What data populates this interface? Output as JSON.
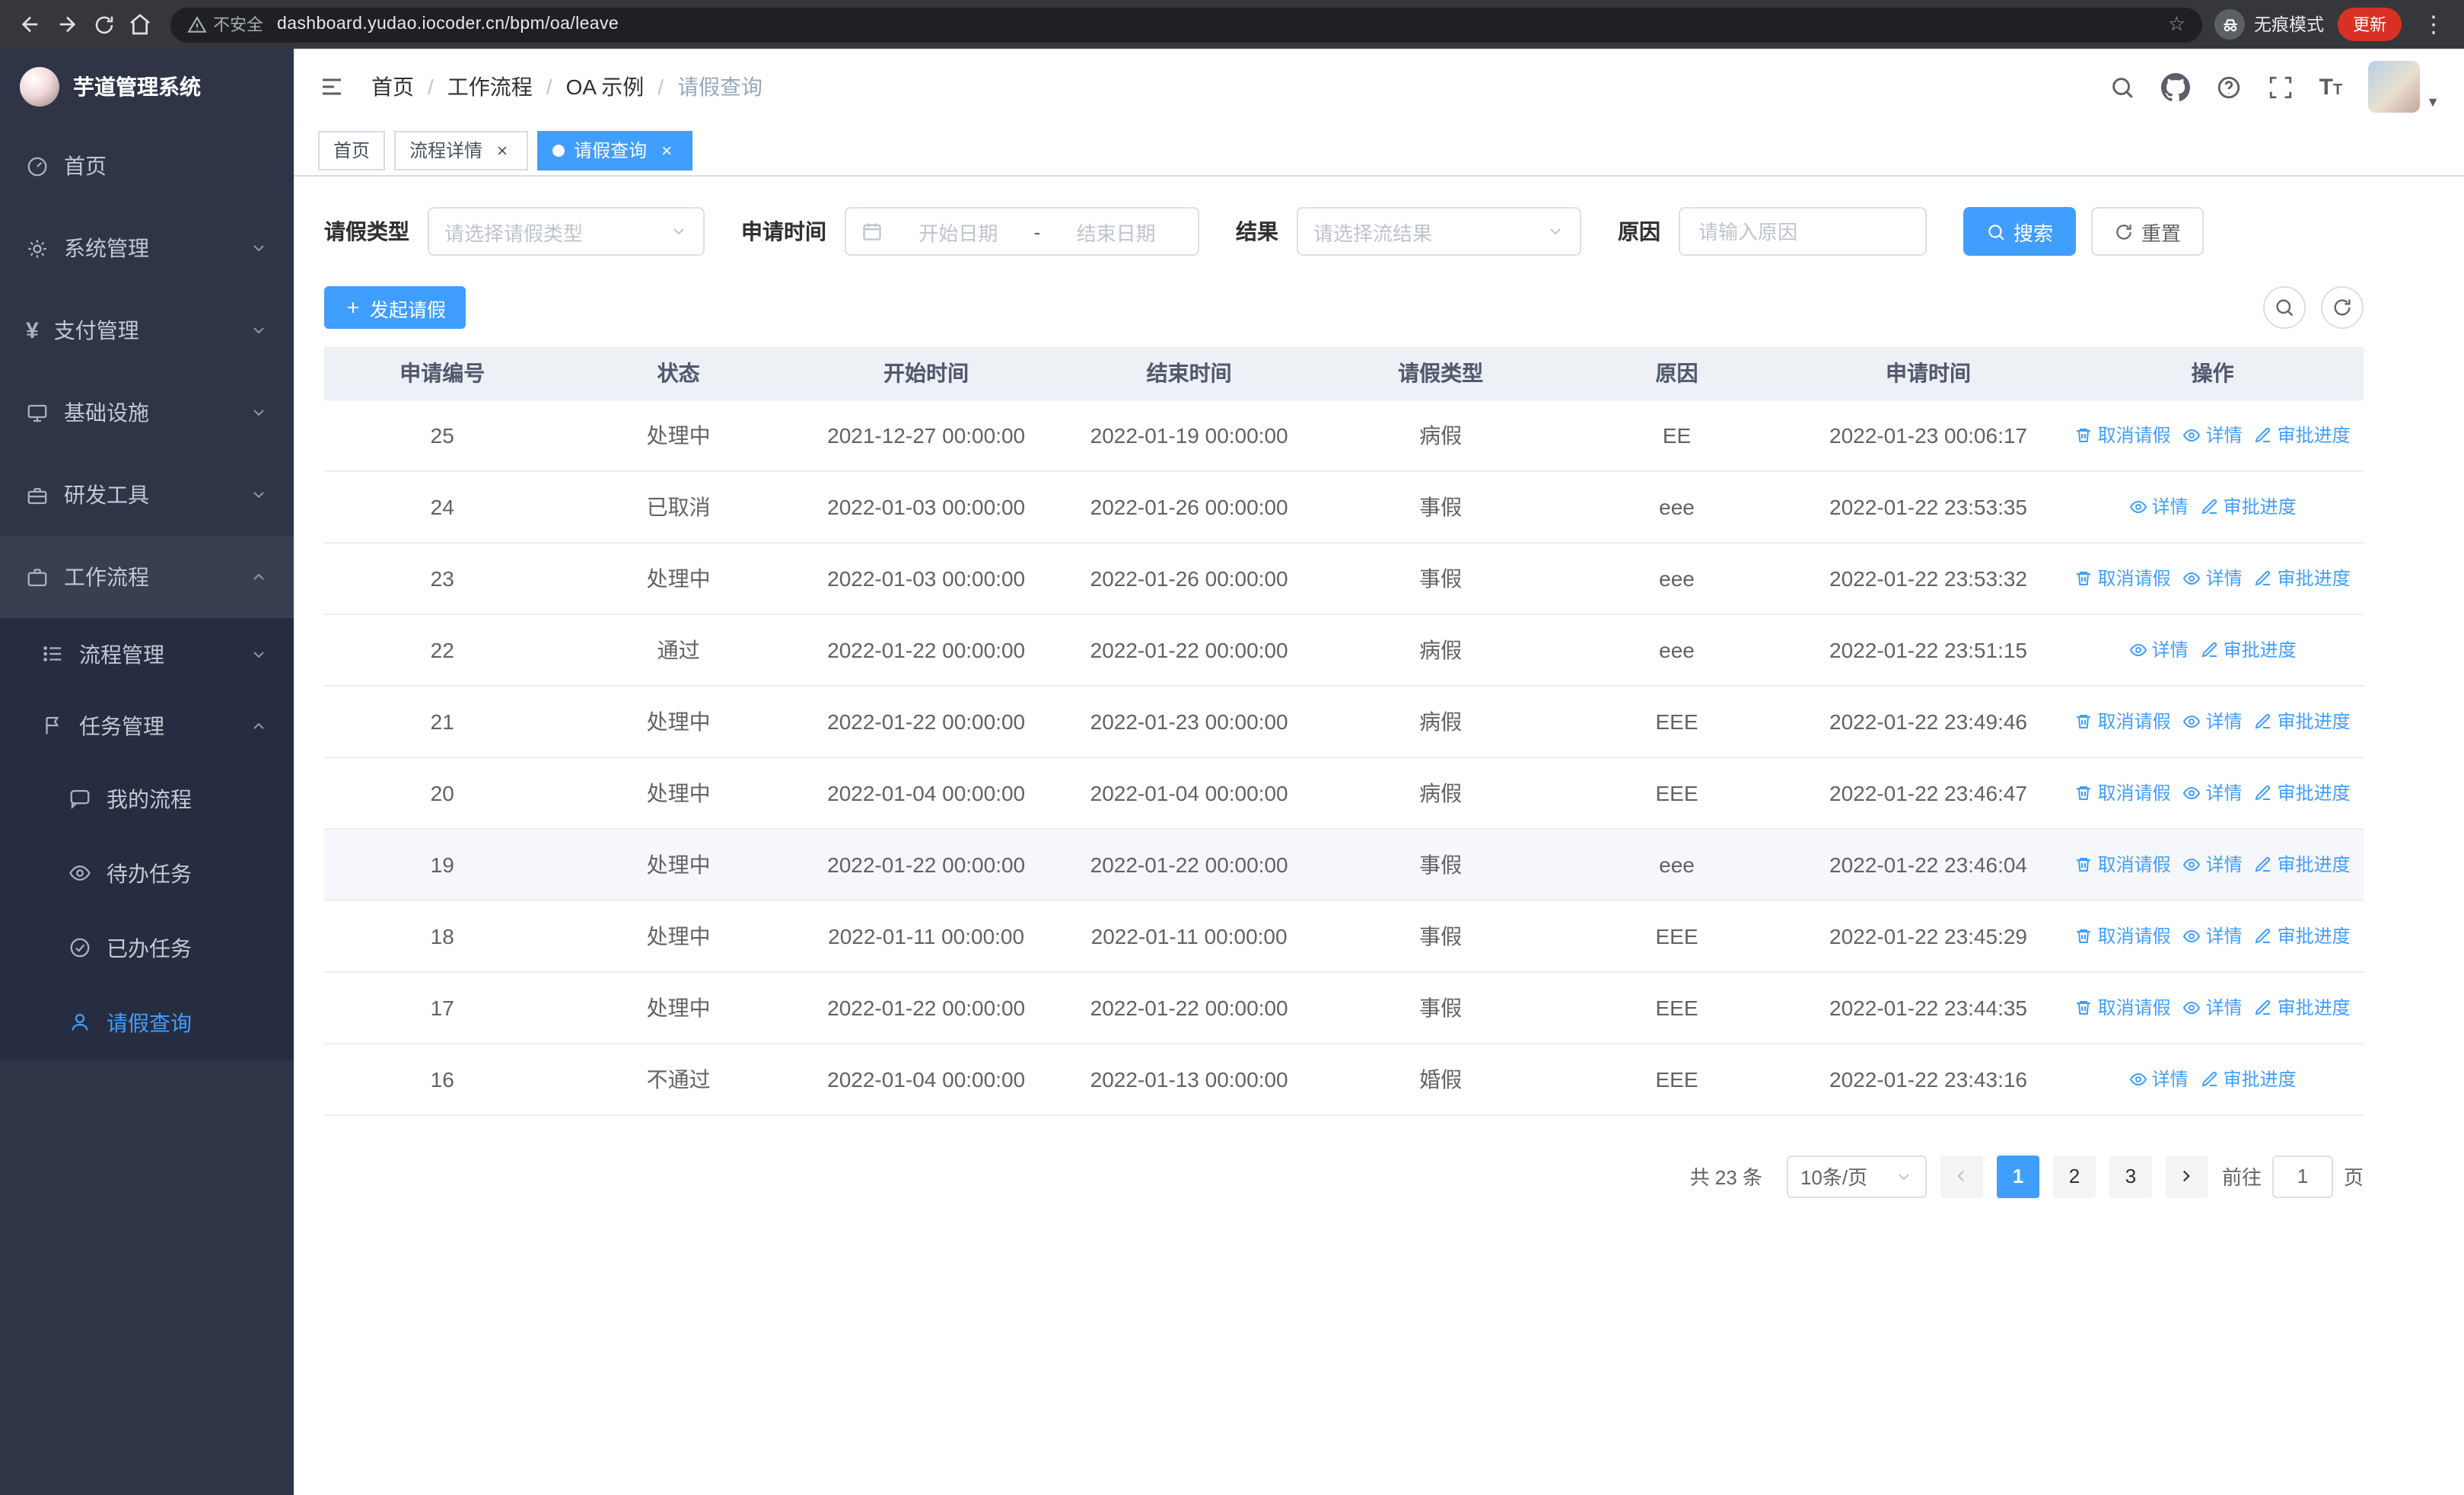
{
  "browser": {
    "security_label": "不安全",
    "url": "dashboard.yudao.iocoder.cn/bpm/oa/leave",
    "incognito_label": "无痕模式",
    "update_label": "更新"
  },
  "sidebar": {
    "app_title": "芋道管理系统",
    "items": [
      {
        "label": "首页"
      },
      {
        "label": "系统管理"
      },
      {
        "label": "支付管理"
      },
      {
        "label": "基础设施"
      },
      {
        "label": "研发工具"
      },
      {
        "label": "工作流程"
      }
    ],
    "workflow_children": [
      {
        "label": "流程管理"
      },
      {
        "label": "任务管理"
      }
    ],
    "task_children": [
      {
        "label": "我的流程"
      },
      {
        "label": "待办任务"
      },
      {
        "label": "已办任务"
      },
      {
        "label": "请假查询"
      }
    ]
  },
  "header": {
    "breadcrumb": [
      "首页",
      "工作流程",
      "OA 示例",
      "请假查询"
    ]
  },
  "tabs": [
    {
      "label": "首页",
      "closable": false,
      "active": false
    },
    {
      "label": "流程详情",
      "closable": true,
      "active": false
    },
    {
      "label": "请假查询",
      "closable": true,
      "active": true
    }
  ],
  "filters": {
    "leave_type_label": "请假类型",
    "leave_type_placeholder": "请选择请假类型",
    "apply_time_label": "申请时间",
    "start_date_placeholder": "开始日期",
    "range_separator": "-",
    "end_date_placeholder": "结束日期",
    "result_label": "结果",
    "result_placeholder": "请选择流结果",
    "reason_label": "原因",
    "reason_placeholder": "请输入原因",
    "search_label": "搜索",
    "reset_label": "重置"
  },
  "toolbar": {
    "create_label": "发起请假"
  },
  "icons": {
    "cancel_action": "trash-icon",
    "detail_action": "eye-icon",
    "progress_action": "edit-icon",
    "search_button": "magnifier-icon",
    "reset_button": "refresh-icon",
    "create_button": "plus-icon"
  },
  "table": {
    "columns": [
      "申请编号",
      "状态",
      "开始时间",
      "结束时间",
      "请假类型",
      "原因",
      "申请时间",
      "操作"
    ],
    "action_labels": {
      "cancel": "取消请假",
      "detail": "详情",
      "progress": "审批进度"
    },
    "rows": [
      {
        "id": "25",
        "status": "处理中",
        "start": "2021-12-27 00:00:00",
        "end": "2022-01-19 00:00:00",
        "type": "病假",
        "reason": "EE",
        "applied": "2022-01-23 00:06:17",
        "actions": [
          "cancel",
          "detail",
          "progress"
        ]
      },
      {
        "id": "24",
        "status": "已取消",
        "start": "2022-01-03 00:00:00",
        "end": "2022-01-26 00:00:00",
        "type": "事假",
        "reason": "eee",
        "applied": "2022-01-22 23:53:35",
        "actions": [
          "detail",
          "progress"
        ]
      },
      {
        "id": "23",
        "status": "处理中",
        "start": "2022-01-03 00:00:00",
        "end": "2022-01-26 00:00:00",
        "type": "事假",
        "reason": "eee",
        "applied": "2022-01-22 23:53:32",
        "actions": [
          "cancel",
          "detail",
          "progress"
        ]
      },
      {
        "id": "22",
        "status": "通过",
        "start": "2022-01-22 00:00:00",
        "end": "2022-01-22 00:00:00",
        "type": "病假",
        "reason": "eee",
        "applied": "2022-01-22 23:51:15",
        "actions": [
          "detail",
          "progress"
        ]
      },
      {
        "id": "21",
        "status": "处理中",
        "start": "2022-01-22 00:00:00",
        "end": "2022-01-23 00:00:00",
        "type": "病假",
        "reason": "EEE",
        "applied": "2022-01-22 23:49:46",
        "actions": [
          "cancel",
          "detail",
          "progress"
        ]
      },
      {
        "id": "20",
        "status": "处理中",
        "start": "2022-01-04 00:00:00",
        "end": "2022-01-04 00:00:00",
        "type": "病假",
        "reason": "EEE",
        "applied": "2022-01-22 23:46:47",
        "actions": [
          "cancel",
          "detail",
          "progress"
        ]
      },
      {
        "id": "19",
        "status": "处理中",
        "start": "2022-01-22 00:00:00",
        "end": "2022-01-22 00:00:00",
        "type": "事假",
        "reason": "eee",
        "applied": "2022-01-22 23:46:04",
        "actions": [
          "cancel",
          "detail",
          "progress"
        ],
        "highlighted": true
      },
      {
        "id": "18",
        "status": "处理中",
        "start": "2022-01-11 00:00:00",
        "end": "2022-01-11 00:00:00",
        "type": "事假",
        "reason": "EEE",
        "applied": "2022-01-22 23:45:29",
        "actions": [
          "cancel",
          "detail",
          "progress"
        ]
      },
      {
        "id": "17",
        "status": "处理中",
        "start": "2022-01-22 00:00:00",
        "end": "2022-01-22 00:00:00",
        "type": "事假",
        "reason": "EEE",
        "applied": "2022-01-22 23:44:35",
        "actions": [
          "cancel",
          "detail",
          "progress"
        ]
      },
      {
        "id": "16",
        "status": "不通过",
        "start": "2022-01-04 00:00:00",
        "end": "2022-01-13 00:00:00",
        "type": "婚假",
        "reason": "EEE",
        "applied": "2022-01-22 23:43:16",
        "actions": [
          "detail",
          "progress"
        ]
      }
    ]
  },
  "pagination": {
    "total": "共 23 条",
    "page_size": "10条/页",
    "pages": [
      "1",
      "2",
      "3"
    ],
    "active_page": "1",
    "goto_label": "前往",
    "goto_value": "1",
    "unit_label": "页"
  }
}
